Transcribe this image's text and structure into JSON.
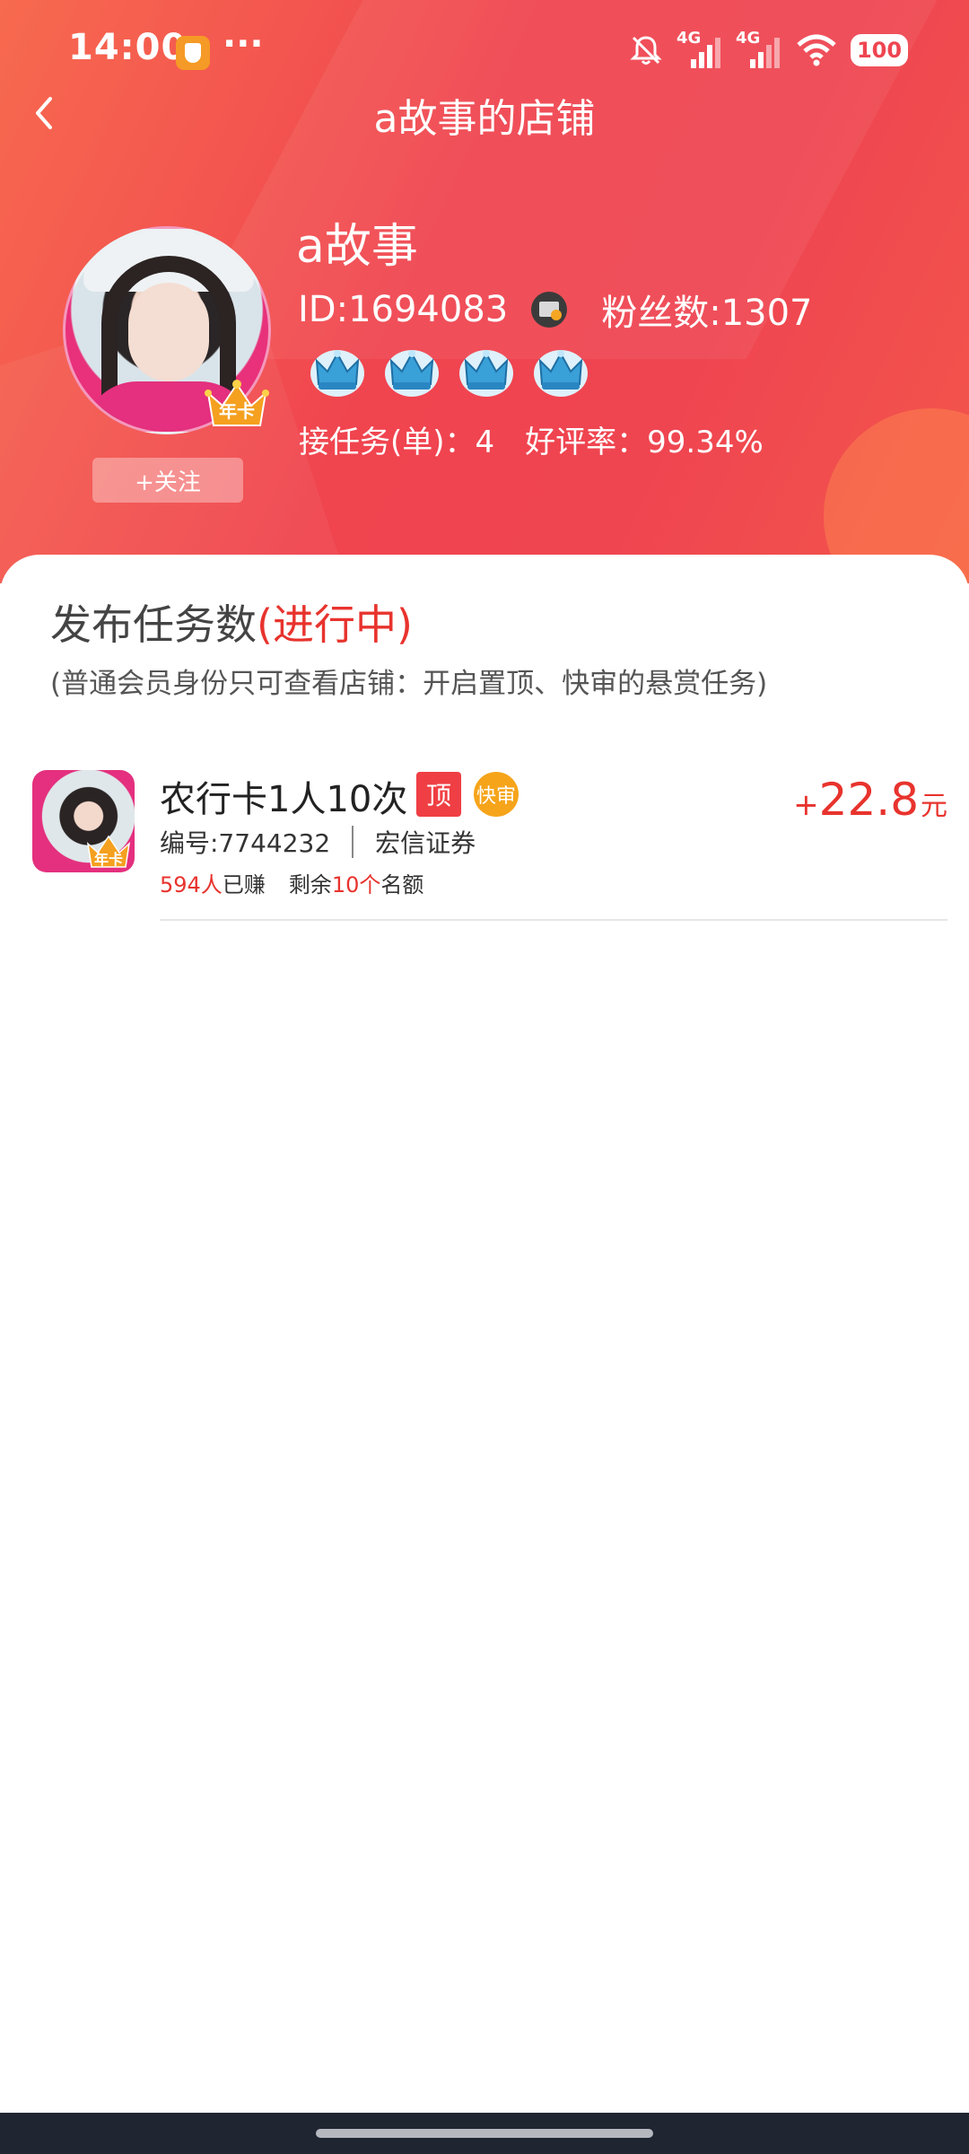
{
  "status_bar": {
    "time": "14:00",
    "dots": "···",
    "network_1": "4G",
    "network_2": "4G",
    "battery": "100",
    "icons": [
      "app-shield-icon",
      "bell-muted-icon",
      "signal-icon",
      "signal-icon",
      "wifi-icon",
      "battery-icon"
    ]
  },
  "header": {
    "title": "a故事的店铺",
    "back_icon": "chevron-left-icon"
  },
  "profile": {
    "name": "a故事",
    "id_text": "ID:1694083",
    "fans_text": "粉丝数:1307",
    "tasks_text": "接任务(单)：4",
    "rating_text": "好评率：99.34%",
    "avatar_badge": "年卡",
    "follow_label": "+关注",
    "level_icons": [
      "crown-icon",
      "crown-icon",
      "crown-icon",
      "crown-icon"
    ],
    "colors": {
      "header_gradient_start": "#f76a4f",
      "header_gradient_end": "#ef4551"
    }
  },
  "section": {
    "title": "发布任务数",
    "status": "(进行中)",
    "note": "(普通会员身份只可查看店铺：开启置顶、快审的悬赏任务)"
  },
  "tasks": [
    {
      "title": "农行卡1人10次",
      "badge_top": "顶",
      "badge_fast": "快审",
      "thumb_badge": "年卡",
      "number": "编号:7744232",
      "company": "宏信证券",
      "earned_count": "594人",
      "earned_label": "已赚",
      "remaining_label": "剩余",
      "remaining_count": "10个",
      "remaining_suffix": "名额",
      "reward_plus": "+",
      "reward_amount": "22.8",
      "reward_unit": "元"
    }
  ],
  "accent_color": "#e8332d"
}
